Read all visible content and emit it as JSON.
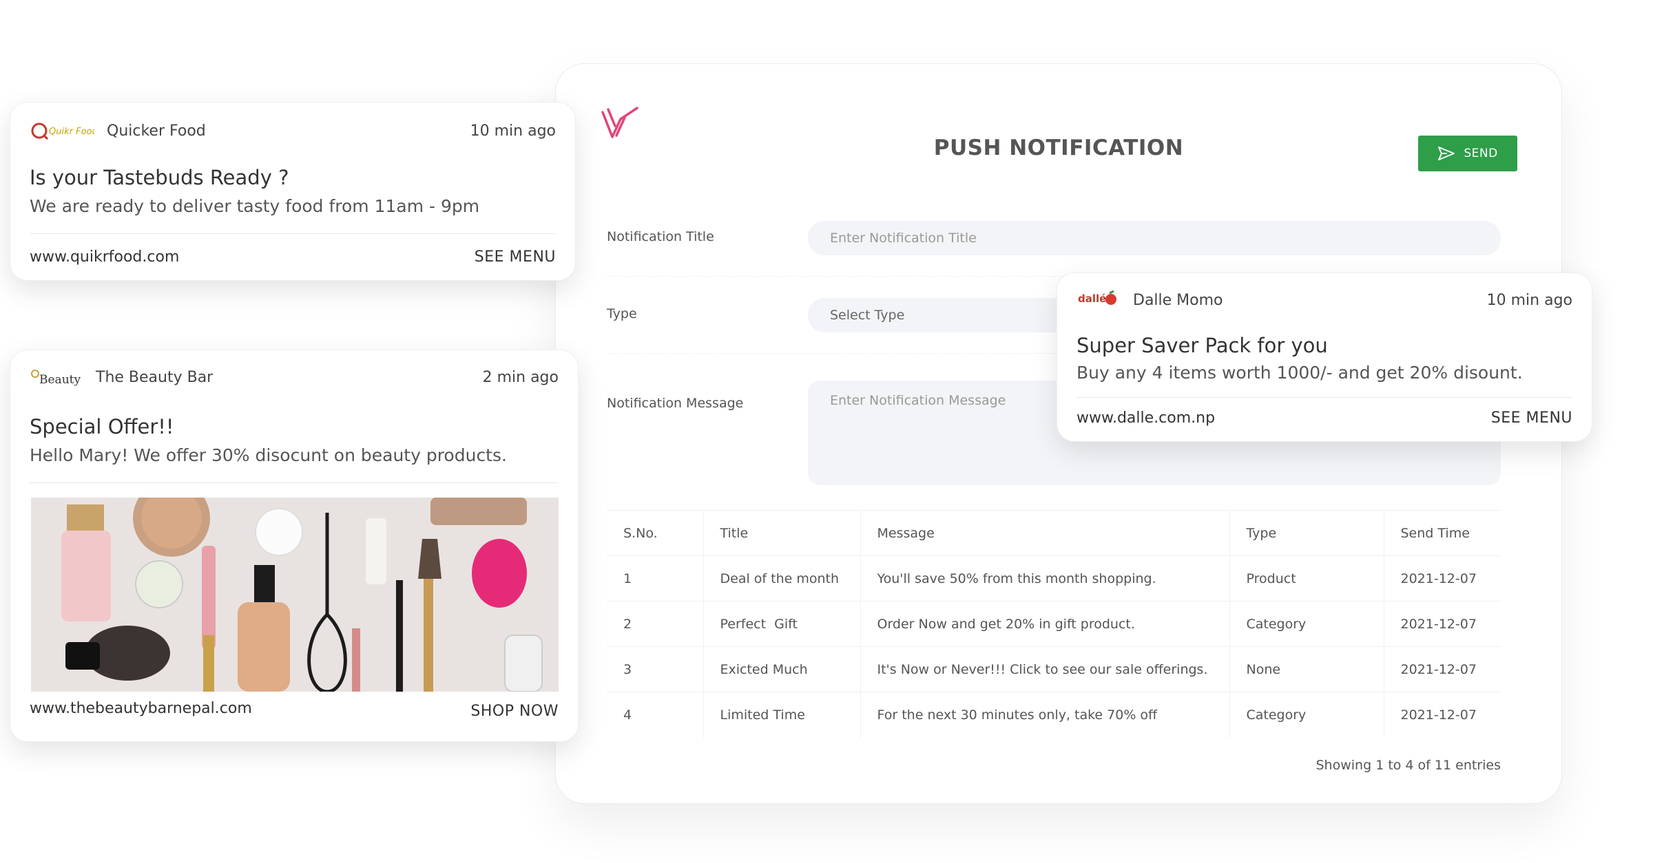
{
  "panel": {
    "title": "PUSH NOTIFICATION",
    "send_label": "SEND",
    "form": {
      "title_label": "Notification Title",
      "title_placeholder": "Enter Notification Title",
      "type_label": "Type",
      "type_value": "Select Type",
      "message_label": "Notification Message",
      "message_placeholder": "Enter Notification Message"
    },
    "table": {
      "headers": [
        "S.No.",
        "Title",
        "Message",
        "Type",
        "Send Time"
      ],
      "rows": [
        [
          "1",
          "Deal of the month",
          "You'll save 50% from this month shopping.",
          "Product",
          "2021-12-07"
        ],
        [
          "2",
          "Perfect  Gift",
          "Order Now and get 20% in gift product.",
          "Category",
          "2021-12-07"
        ],
        [
          "3",
          "Exicted Much",
          "It's Now or Never!!! Click to see our sale offerings.",
          "None",
          "2021-12-07"
        ],
        [
          "4",
          "Limited Time",
          "For the next 30 minutes only, take 70% off",
          "Category",
          "2021-12-07"
        ]
      ]
    },
    "entries_text": "Showing 1 to 4 of 11 entries"
  },
  "cards": {
    "quicker": {
      "logo_text": "Quikr Food",
      "brand": "Quicker Food",
      "time": "10 min ago",
      "title": "Is your Tastebuds Ready ?",
      "message": "We are ready to deliver tasty food from 11am - 9pm",
      "url": "www.quikrfood.com",
      "cta": "SEE MENU"
    },
    "beauty": {
      "logo_text": "Beauty",
      "brand": "The Beauty Bar",
      "time": "2 min ago",
      "title": "Special Offer!!",
      "message": "Hello Mary! We offer 30% disocunt on beauty products.",
      "url": "www.thebeautybarnepal.com",
      "cta": "SHOP NOW"
    },
    "dalle": {
      "logo_text": "dallé",
      "brand": "Dalle Momo",
      "time": "10 min ago",
      "title": "Super Saver Pack for you",
      "message": "Buy any 4 items worth 1000/- and get 20% disount.",
      "url": "www.dalle.com.np",
      "cta": "SEE MENU"
    }
  },
  "colors": {
    "send_button": "#2e9e49",
    "logo_accent": "#e0457b"
  },
  "icons": [
    "brand-logo-icon",
    "send-icon"
  ]
}
